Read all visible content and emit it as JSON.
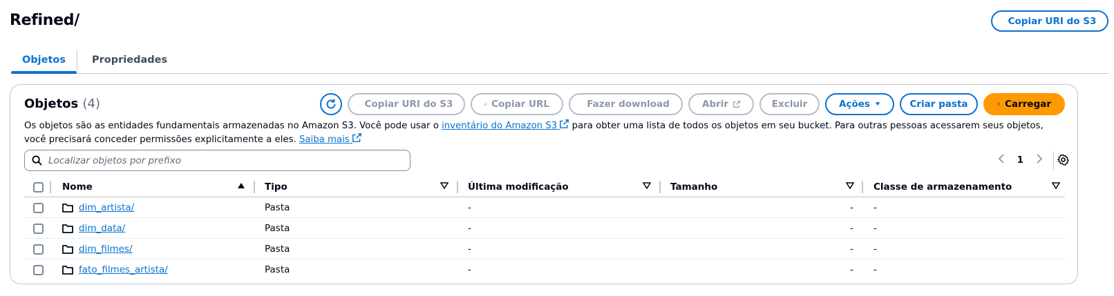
{
  "header": {
    "title": "Refined/",
    "copy_uri_label": "Copiar URI do S3"
  },
  "tabs": [
    {
      "label": "Objetos",
      "active": true
    },
    {
      "label": "Propriedades",
      "active": false
    }
  ],
  "objects_panel": {
    "title": "Objetos",
    "count": "(4)",
    "toolbar": {
      "copy_uri": "Copiar URI do S3",
      "copy_url": "Copiar URL",
      "download": "Fazer download",
      "open": "Abrir",
      "delete": "Excluir",
      "actions": "Ações",
      "create_folder": "Criar pasta",
      "upload": "Carregar"
    },
    "description": {
      "part1": "Os objetos são as entidades fundamentais armazenadas no Amazon S3. Você pode usar o ",
      "link1": "inventário do Amazon S3",
      "part2": " para obter uma lista de todos os objetos em seu bucket. Para outras pessoas acessarem seus objetos, você precisará conceder permissões explicitamente a eles. ",
      "link2": "Saiba mais"
    },
    "search": {
      "placeholder": "Localizar objetos por prefixo",
      "value": ""
    },
    "pagination": {
      "current_page": "1"
    }
  },
  "table": {
    "columns": [
      "Nome",
      "Tipo",
      "Última modificação",
      "Tamanho",
      "Classe de armazenamento"
    ],
    "rows": [
      {
        "name": "dim_artista/",
        "type": "Pasta",
        "modified": "-",
        "size": "-",
        "class": "-"
      },
      {
        "name": "dim_data/",
        "type": "Pasta",
        "modified": "-",
        "size": "-",
        "class": "-"
      },
      {
        "name": "dim_filmes/",
        "type": "Pasta",
        "modified": "-",
        "size": "-",
        "class": "-"
      },
      {
        "name": "fato_filmes_artista/",
        "type": "Pasta",
        "modified": "-",
        "size": "-",
        "class": "-"
      }
    ]
  },
  "colors": {
    "accent": "#0972d3",
    "primary_button": "#ff9900",
    "disabled": "#8d99a8"
  },
  "icons": [
    "copy-icon",
    "refresh-icon",
    "download-icon",
    "external-link-icon",
    "caret-down-icon",
    "upload-icon",
    "search-icon",
    "chevron-left-icon",
    "chevron-right-icon",
    "settings-icon",
    "folder-icon",
    "sort-ascending-icon",
    "sort-icon"
  ]
}
